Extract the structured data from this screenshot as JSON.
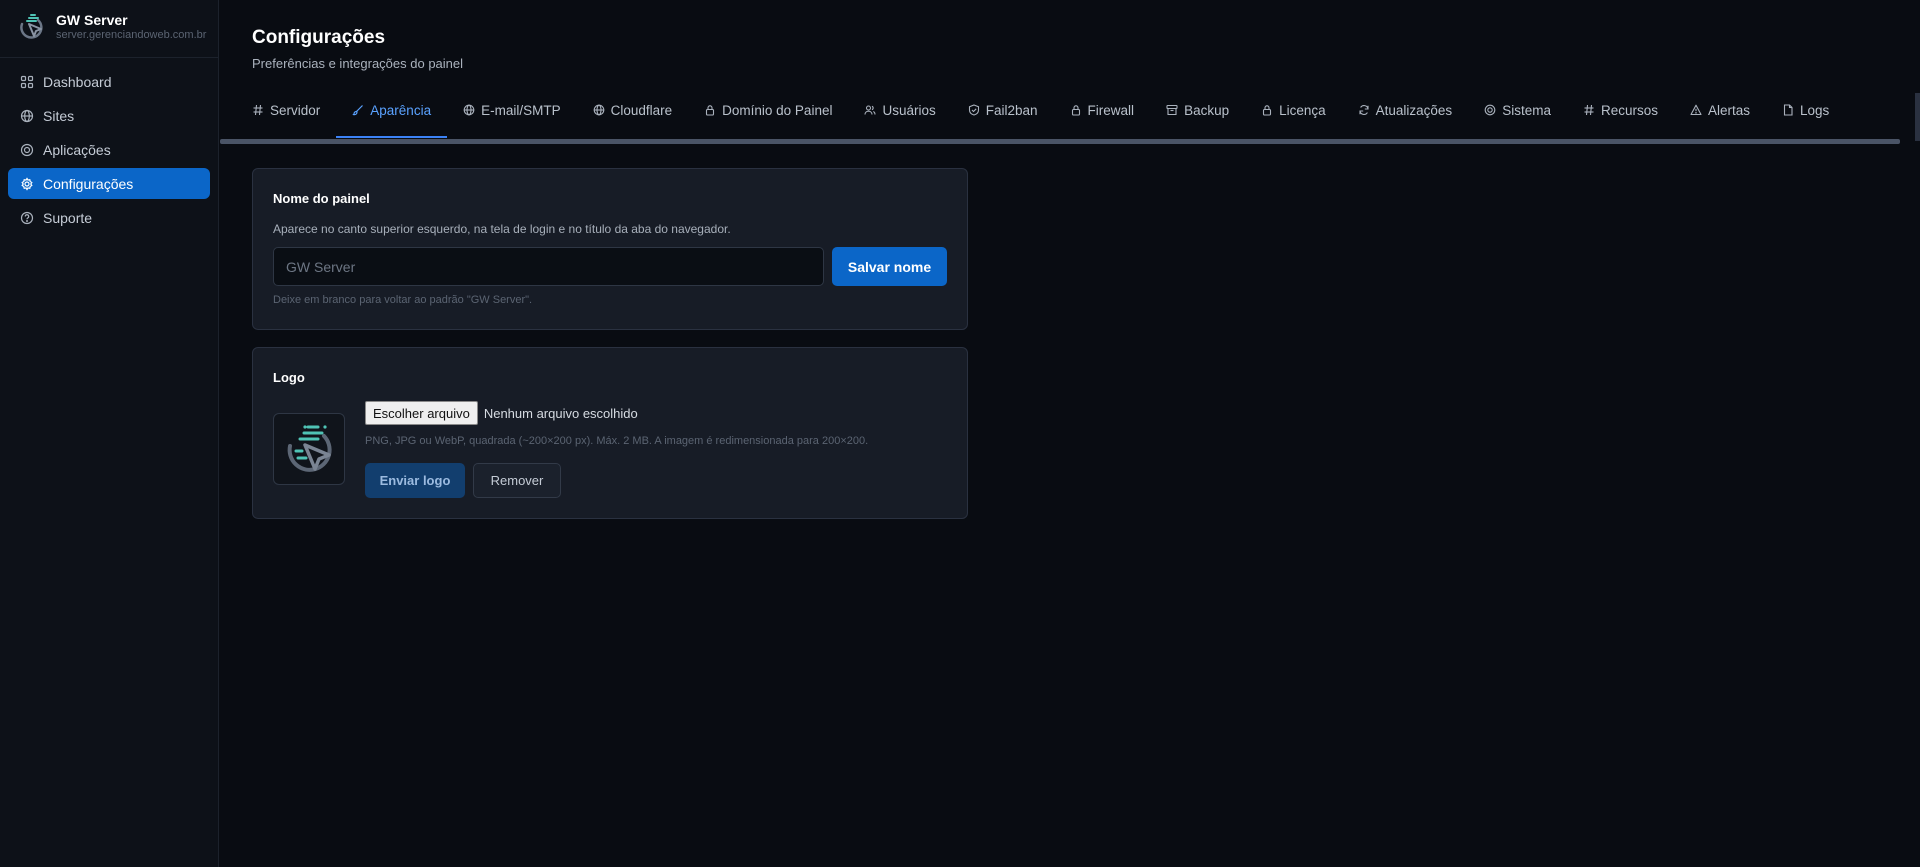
{
  "sidebar": {
    "brand_name": "GW Server",
    "brand_host": "server.gerenciandoweb.com.br",
    "items": [
      {
        "label": "Dashboard",
        "icon": "grid-icon"
      },
      {
        "label": "Sites",
        "icon": "globe-icon"
      },
      {
        "label": "Aplicações",
        "icon": "cube-icon"
      },
      {
        "label": "Configurações",
        "icon": "gear-icon",
        "active": true
      },
      {
        "label": "Suporte",
        "icon": "help-circle-icon"
      }
    ]
  },
  "header": {
    "title": "Configurações",
    "subtitle": "Preferências e integrações do painel"
  },
  "tabs": [
    {
      "label": "Servidor",
      "icon": "hash-icon"
    },
    {
      "label": "Aparência",
      "icon": "brush-icon",
      "active": true
    },
    {
      "label": "E-mail/SMTP",
      "icon": "globe-icon"
    },
    {
      "label": "Cloudflare",
      "icon": "globe-icon"
    },
    {
      "label": "Domínio do Painel",
      "icon": "lock-icon"
    },
    {
      "label": "Usuários",
      "icon": "users-icon"
    },
    {
      "label": "Fail2ban",
      "icon": "shield-icon"
    },
    {
      "label": "Firewall",
      "icon": "lock-icon"
    },
    {
      "label": "Backup",
      "icon": "archive-icon"
    },
    {
      "label": "Licença",
      "icon": "lock-icon"
    },
    {
      "label": "Atualizações",
      "icon": "refresh-icon"
    },
    {
      "label": "Sistema",
      "icon": "cube-icon"
    },
    {
      "label": "Recursos",
      "icon": "hash-icon"
    },
    {
      "label": "Alertas",
      "icon": "warning-icon"
    },
    {
      "label": "Logs",
      "icon": "file-icon"
    }
  ],
  "panel_name": {
    "title": "Nome do painel",
    "description": "Aparece no canto superior esquerdo, na tela de login e no título da aba do navegador.",
    "input_value": "",
    "input_placeholder": "GW Server",
    "save_label": "Salvar nome",
    "hint": "Deixe em branco para voltar ao padrão \"GW Server\"."
  },
  "logo": {
    "title": "Logo",
    "file_button": "Escolher arquivo",
    "file_status": "Nenhum arquivo escolhido",
    "hint": "PNG, JPG ou WebP, quadrada (~200×200 px). Máx. 2 MB. A imagem é redimensionada para 200×200.",
    "upload_label": "Enviar logo",
    "remove_label": "Remover"
  },
  "colors": {
    "accent": "#0b66c8",
    "active_tab": "#5aa2ff",
    "logo_teal": "#4fc3b5"
  }
}
